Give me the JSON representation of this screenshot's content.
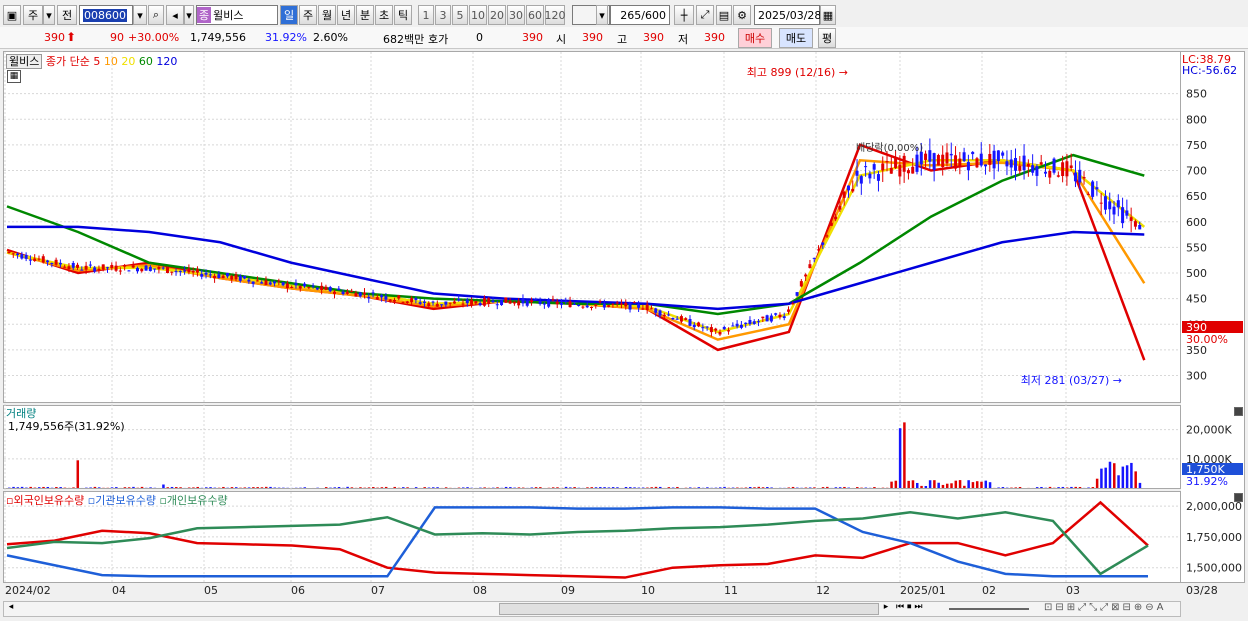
{
  "toolbar": {
    "mode": "주",
    "prev": "전",
    "code": "008600",
    "name": "윌비스",
    "name_badge": "종",
    "periods": [
      "일",
      "주",
      "월",
      "년",
      "분",
      "초",
      "틱"
    ],
    "active_period": "일",
    "intervals": [
      "1",
      "3",
      "5",
      "10",
      "20",
      "30",
      "60",
      "120"
    ],
    "count": "265",
    "count_max": "/600",
    "date": "2025/03/28"
  },
  "quote": {
    "price": "390",
    "change": "90",
    "change_pct": "+30.00%",
    "volume": "1,749,556",
    "vol_ratio": "31.92%",
    "turnover_pct": "2.60%",
    "amount": "682백만",
    "hoga_label": "호가",
    "hoga_value": "0",
    "hoga_price": "390",
    "open_label": "시",
    "open": "390",
    "high_label": "고",
    "high": "390",
    "low_label": "저",
    "low": "390",
    "buy": "매수",
    "sell": "매도",
    "avg": "평"
  },
  "price_pane": {
    "title": "윌비스",
    "ma_label": "종가 단순",
    "ma_periods": [
      "5",
      "10",
      "20",
      "60",
      "120"
    ],
    "ma_colors": [
      "#e00000",
      "#ff9900",
      "#f0e000",
      "#008800",
      "#0000dd"
    ],
    "lc": "LC:38.79",
    "hc": "HC:-56.62",
    "high_note": "최고 899 (12/16)",
    "low_note": "최저 281 (03/27)",
    "event_note": "배당락(0.00%)",
    "price_tag": "390",
    "pct_tag": "30.00%",
    "y_ticks": [
      "850",
      "800",
      "750",
      "700",
      "650",
      "600",
      "550",
      "500",
      "450",
      "400",
      "350",
      "300"
    ]
  },
  "volume_pane": {
    "title": "거래량",
    "value_text": "1,749,556주(31.92%)",
    "y_ticks": [
      "20,000K",
      "10,000K"
    ],
    "tag": "1,750K",
    "tag2": "31.92%"
  },
  "holdings_pane": {
    "legends": [
      "외국인보유수량",
      "기관보유수량",
      "개인보유수량"
    ],
    "colors": [
      "#e00000",
      "#1e5fd8",
      "#2e8b57"
    ],
    "y_ticks": [
      "2,000,000",
      "1,750,000",
      "1,500,000"
    ]
  },
  "x_axis": {
    "labels": [
      "2024/02",
      "04",
      "05",
      "06",
      "07",
      "08",
      "09",
      "10",
      "11",
      "12",
      "2025/01",
      "02",
      "03"
    ],
    "last_date": "03/28"
  },
  "chart_data": {
    "type": "candlestick",
    "symbol": "윌비스",
    "x_range": [
      "2024/02",
      "2025/03/28"
    ],
    "y_range": [
      260,
      900
    ],
    "high": 899,
    "high_date": "12/16",
    "low": 281,
    "low_date": "03/27",
    "last_close": 390,
    "series": [
      {
        "name": "5",
        "approx_path": [
          545,
          500,
          520,
          490,
          470,
          455,
          430,
          445,
          440,
          430,
          350,
          385,
          750,
          700,
          720,
          700,
          330
        ]
      },
      {
        "name": "10",
        "approx_path": [
          540,
          505,
          515,
          490,
          470,
          455,
          435,
          445,
          440,
          430,
          370,
          400,
          720,
          710,
          715,
          700,
          480
        ]
      },
      {
        "name": "20",
        "approx_path": [
          540,
          510,
          510,
          495,
          475,
          460,
          440,
          445,
          440,
          435,
          385,
          420,
          690,
          720,
          720,
          700,
          590
        ]
      },
      {
        "name": "60",
        "approx_path": [
          630,
          580,
          520,
          500,
          480,
          460,
          450,
          445,
          440,
          440,
          420,
          440,
          520,
          610,
          680,
          730,
          690
        ]
      },
      {
        "name": "120",
        "approx_path": [
          590,
          590,
          580,
          560,
          520,
          490,
          460,
          450,
          445,
          440,
          430,
          440,
          480,
          520,
          560,
          580,
          575
        ]
      }
    ]
  }
}
